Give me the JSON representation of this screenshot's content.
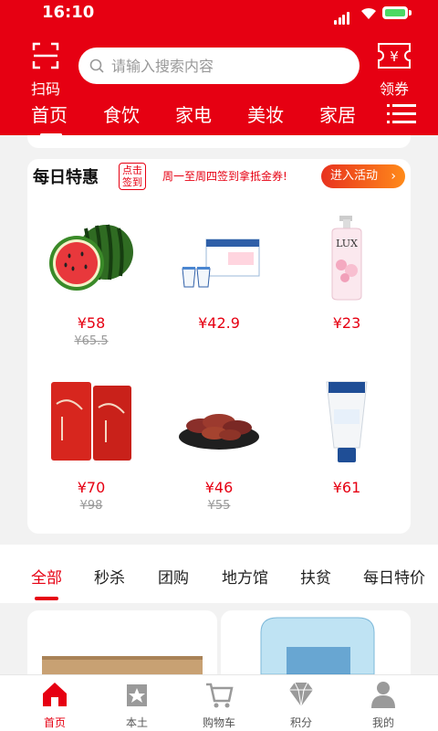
{
  "status_bar": {
    "time": "16:10"
  },
  "header": {
    "scan_label": "扫码",
    "search_placeholder": "请输入搜索内容",
    "coupon_label": "领券",
    "categories": [
      "首页",
      "食饮",
      "家电",
      "美妆",
      "家居"
    ],
    "active_category": "首页",
    "colors": {
      "brand": "#e60012"
    }
  },
  "daily": {
    "title": "每日特惠",
    "badge": "点击签到",
    "badge_lines": [
      "点击",
      "签到"
    ],
    "promo": "周一至周四签到拿抵金券!",
    "enter_button": "进入活动",
    "products": [
      {
        "name": "watermelon",
        "price": "¥58",
        "original": "¥65.5"
      },
      {
        "name": "yogurt-box",
        "price": "¥42.9",
        "original": ""
      },
      {
        "name": "lux-body-wash",
        "price": "¥23",
        "original": ""
      },
      {
        "name": "red-tea-bags",
        "price": "¥70",
        "original": "¥98"
      },
      {
        "name": "roasted-sweet-potato",
        "price": "¥46",
        "original": "¥55"
      },
      {
        "name": "sanosan-cream",
        "price": "¥61",
        "original": ""
      }
    ]
  },
  "tabs": {
    "items": [
      "全部",
      "秒杀",
      "团购",
      "地方馆",
      "扶贫",
      "每日特价"
    ],
    "active": "全部"
  },
  "bottom_nav": {
    "items": [
      {
        "label": "首页",
        "icon": "home-icon"
      },
      {
        "label": "本土",
        "icon": "star-badge-icon"
      },
      {
        "label": "购物车",
        "icon": "cart-icon"
      },
      {
        "label": "积分",
        "icon": "diamond-icon"
      },
      {
        "label": "我的",
        "icon": "user-icon"
      }
    ],
    "active": "首页"
  }
}
